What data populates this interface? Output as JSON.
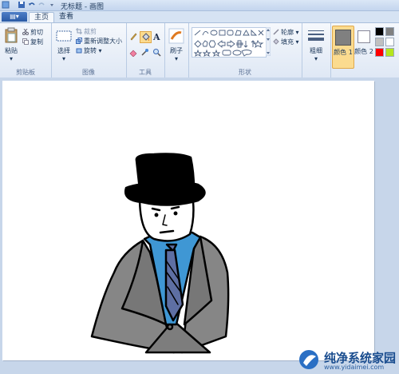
{
  "window": {
    "title": "无标题 - 画图"
  },
  "tabs": {
    "menu_label": "",
    "home": "主页",
    "view": "查看"
  },
  "clipboard": {
    "paste": "粘贴",
    "cut": "剪切",
    "copy": "复制",
    "group": "剪贴板"
  },
  "image": {
    "select": "选择",
    "crop": "裁剪",
    "resize": "重新调整大小",
    "rotate": "旋转",
    "group": "图像"
  },
  "tools": {
    "group": "工具"
  },
  "brushes": {
    "label": "刷子"
  },
  "shapes": {
    "outline": "轮廓",
    "fill": "填充",
    "group": "形状"
  },
  "size": {
    "label": "粗细"
  },
  "colors": {
    "color1": "颜色 1",
    "color2": "颜色 2",
    "color1_value": "#808080",
    "color2_value": "#ffffff",
    "palette": [
      "#000000",
      "#808080",
      "#c0c0c0",
      "#ffffff",
      "#ff0000",
      "#b5e61d"
    ]
  },
  "watermark": {
    "line1": "纯净系统家园",
    "line2": "www.yidaimei.com"
  },
  "icons": {
    "paste": "clipboard-icon",
    "cut": "scissors-icon",
    "copy": "copy-icon",
    "select": "select-rectangle-icon",
    "crop": "crop-icon",
    "resize": "resize-icon",
    "rotate": "rotate-icon",
    "pencil": "pencil-icon",
    "fill": "paint-bucket-icon",
    "text": "text-icon",
    "eraser": "eraser-icon",
    "picker": "color-picker-icon",
    "magnifier": "magnifier-icon",
    "brush": "brush-icon",
    "size": "line-size-icon"
  }
}
